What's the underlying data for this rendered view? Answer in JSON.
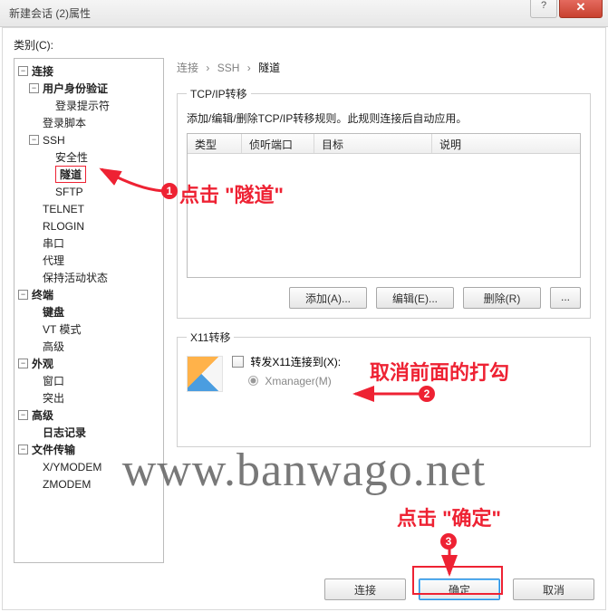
{
  "title": "新建会话 (2)属性",
  "category_label": "类别(C):",
  "tree": {
    "connection": "连接",
    "user_auth": "用户身份验证",
    "login_prompt": "登录提示符",
    "login_script": "登录脚本",
    "ssh": "SSH",
    "security": "安全性",
    "tunnel": "隧道",
    "sftp": "SFTP",
    "telnet": "TELNET",
    "rlogin": "RLOGIN",
    "serial": "串口",
    "proxy": "代理",
    "keepalive": "保持活动状态",
    "terminal": "终端",
    "keyboard": "键盘",
    "vtmode": "VT 模式",
    "advanced_t": "高级",
    "appearance": "外观",
    "window": "窗口",
    "break": "突出",
    "advanced": "高级",
    "logging": "日志记录",
    "filetransfer": "文件传输",
    "xymodem": "X/YMODEM",
    "zmodem": "ZMODEM"
  },
  "breadcrumbs": {
    "a": "连接",
    "b": "SSH",
    "c": "隧道"
  },
  "tcpip": {
    "legend": "TCP/IP转移",
    "desc": "添加/编辑/删除TCP/IP转移规则。此规则连接后自动应用。",
    "cols": {
      "type": "类型",
      "listen": "侦听端口",
      "target": "目标",
      "desc": "说明"
    },
    "btn_add": "添加(A)...",
    "btn_edit": "编辑(E)...",
    "btn_del": "删除(R)",
    "btn_more": "..."
  },
  "x11": {
    "legend": "X11转移",
    "cb_label": "转发X11连接到(X):",
    "radio_xmgr": "Xmanager(M)"
  },
  "footer": {
    "connect": "连接",
    "ok": "确定",
    "cancel": "取消"
  },
  "annotations": {
    "a1": "点击 \"隧道\"",
    "a2": "取消前面的打勾",
    "a3": "点击 \"确定\""
  },
  "watermark": "www.banwago.net"
}
